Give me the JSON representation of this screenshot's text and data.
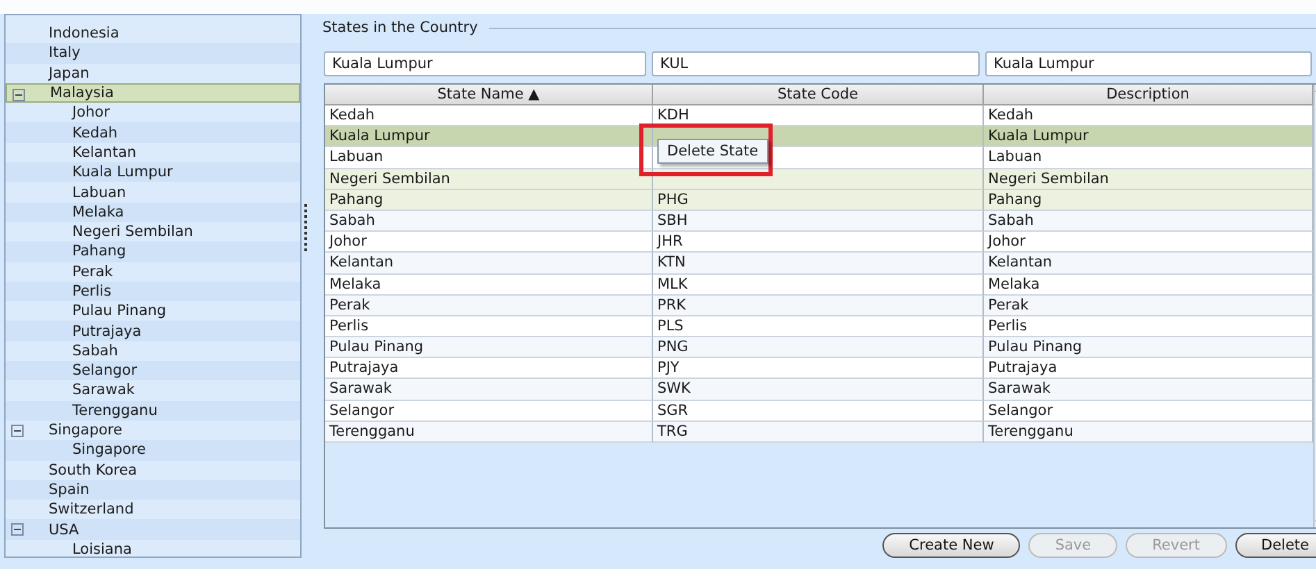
{
  "tree": [
    {
      "label": "Indonesia",
      "selected": false
    },
    {
      "label": "Italy",
      "selected": false
    },
    {
      "label": "Japan",
      "selected": false
    },
    {
      "label": "Malaysia",
      "selected": true,
      "expanded": true,
      "children": [
        {
          "label": "Johor"
        },
        {
          "label": "Kedah"
        },
        {
          "label": "Kelantan"
        },
        {
          "label": "Kuala Lumpur"
        },
        {
          "label": "Labuan"
        },
        {
          "label": "Melaka"
        },
        {
          "label": "Negeri Sembilan"
        },
        {
          "label": "Pahang"
        },
        {
          "label": "Perak"
        },
        {
          "label": "Perlis"
        },
        {
          "label": "Pulau Pinang"
        },
        {
          "label": "Putrajaya"
        },
        {
          "label": "Sabah"
        },
        {
          "label": "Selangor"
        },
        {
          "label": "Sarawak"
        },
        {
          "label": "Terengganu"
        }
      ]
    },
    {
      "label": "Singapore",
      "selected": false,
      "expanded": true,
      "children": [
        {
          "label": "Singapore"
        }
      ]
    },
    {
      "label": "South Korea",
      "selected": false
    },
    {
      "label": "Spain",
      "selected": false
    },
    {
      "label": "Switzerland",
      "selected": false
    },
    {
      "label": "USA",
      "selected": false,
      "expanded": true,
      "children": [
        {
          "label": "Loisiana"
        }
      ]
    }
  ],
  "group": {
    "title": "States in the Country",
    "filters": [
      "Kuala Lumpur",
      "KUL",
      "Kuala Lumpur"
    ],
    "columns": [
      {
        "label": "State Name ▲"
      },
      {
        "label": "State Code"
      },
      {
        "label": "Description"
      }
    ],
    "rows": [
      {
        "cells": [
          "Kedah",
          "KDH",
          "Kedah"
        ],
        "selected": false,
        "current": false
      },
      {
        "cells": [
          "Kuala Lumpur",
          null,
          "Kuala Lumpur"
        ],
        "selected": true,
        "current": true
      },
      {
        "cells": [
          "Labuan",
          null,
          "Labuan"
        ],
        "selected": false,
        "current": false
      },
      {
        "cells": [
          "Negeri Sembilan",
          null,
          "Negeri Sembilan"
        ],
        "selected": true,
        "current": false
      },
      {
        "cells": [
          "Pahang",
          "PHG",
          "Pahang"
        ],
        "selected": true,
        "current": false
      },
      {
        "cells": [
          "Sabah",
          "SBH",
          "Sabah"
        ],
        "selected": false,
        "current": false
      },
      {
        "cells": [
          "Johor",
          "JHR",
          "Johor"
        ],
        "selected": false,
        "current": false
      },
      {
        "cells": [
          "Kelantan",
          "KTN",
          "Kelantan"
        ],
        "selected": false,
        "current": false
      },
      {
        "cells": [
          "Melaka",
          "MLK",
          "Melaka"
        ],
        "selected": false,
        "current": false
      },
      {
        "cells": [
          "Perak",
          "PRK",
          "Perak"
        ],
        "selected": false,
        "current": false
      },
      {
        "cells": [
          "Perlis",
          "PLS",
          "Perlis"
        ],
        "selected": false,
        "current": false
      },
      {
        "cells": [
          "Pulau Pinang",
          "PNG",
          "Pulau Pinang"
        ],
        "selected": false,
        "current": false
      },
      {
        "cells": [
          "Putrajaya",
          "PJY",
          "Putrajaya"
        ],
        "selected": false,
        "current": false
      },
      {
        "cells": [
          "Sarawak",
          "SWK",
          "Sarawak"
        ],
        "selected": false,
        "current": false
      },
      {
        "cells": [
          "Selangor",
          "SGR",
          "Selangor"
        ],
        "selected": false,
        "current": false
      },
      {
        "cells": [
          "Terengganu",
          "TRG",
          "Terengganu"
        ],
        "selected": false,
        "current": false
      }
    ],
    "context_menu": {
      "items": [
        "Delete State"
      ]
    },
    "buttons": [
      {
        "label": "Create New",
        "disabled": false
      },
      {
        "label": "Save",
        "disabled": true
      },
      {
        "label": "Revert",
        "disabled": true
      },
      {
        "label": "Delete",
        "disabled": false
      }
    ]
  }
}
